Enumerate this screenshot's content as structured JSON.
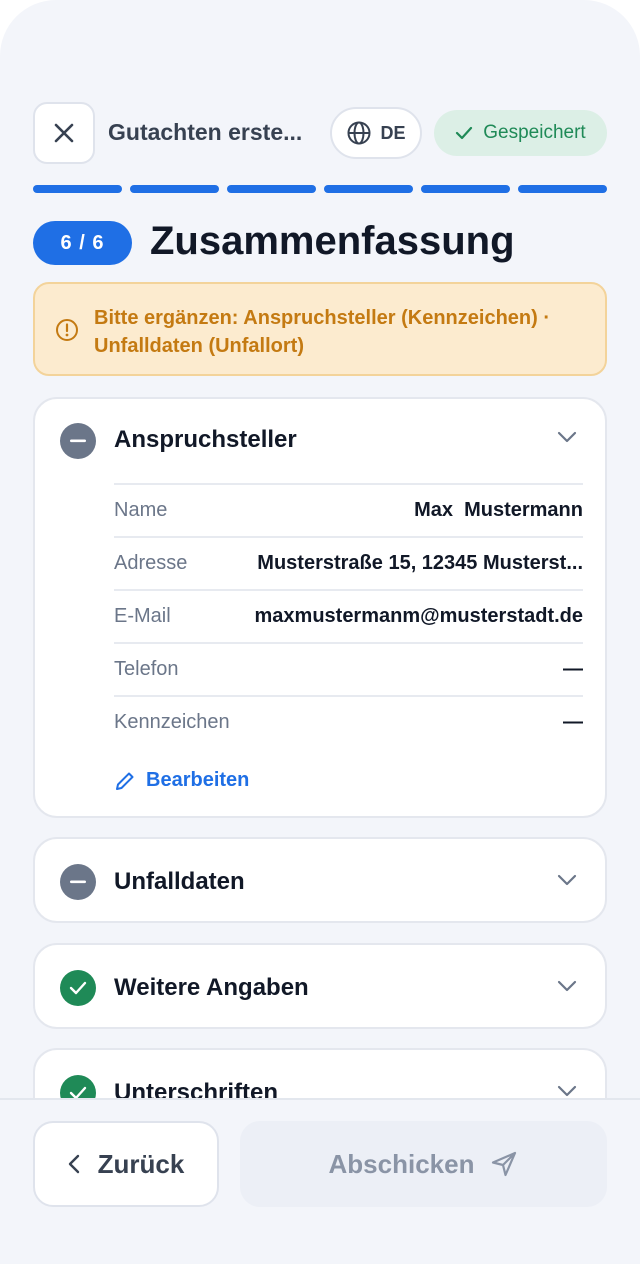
{
  "header": {
    "close_icon": "close-icon",
    "title": "Gutachten erste...",
    "language": "DE",
    "saved_label": "Gespeichert"
  },
  "progress": {
    "steps_total": 6,
    "steps_completed": 6
  },
  "step": {
    "indicator": "6 / 6",
    "title": "Zusammenfassung"
  },
  "warning": {
    "text": "Bitte ergänzen: Anspruchsteller (Kennzeichen) · Unfalldaten (Unfallort)"
  },
  "sections": [
    {
      "title": "Anspruchsteller",
      "status": "incomplete",
      "expanded": true,
      "rows": [
        {
          "label": "Name",
          "value": "Max  Mustermann"
        },
        {
          "label": "Adresse",
          "value": "Musterstraße 15, 12345 Musterst..."
        },
        {
          "label": "E-Mail",
          "value": "maxmustermanm@musterstadt.de"
        },
        {
          "label": "Telefon",
          "value": "—"
        },
        {
          "label": "Kennzeichen",
          "value": "—"
        }
      ],
      "edit_label": "Bearbeiten"
    },
    {
      "title": "Unfalldaten",
      "status": "incomplete",
      "expanded": false
    },
    {
      "title": "Weitere Angaben",
      "status": "complete",
      "expanded": false
    },
    {
      "title": "Unterschriften",
      "status": "complete",
      "expanded": false
    }
  ],
  "footer": {
    "back_label": "Zurück",
    "submit_label": "Abschicken"
  },
  "colors": {
    "accent": "#1f6fe5",
    "success": "#1f8a57",
    "warning_text": "#c47a12",
    "warning_bg": "#fcebcf",
    "pending": "#6b7689"
  }
}
